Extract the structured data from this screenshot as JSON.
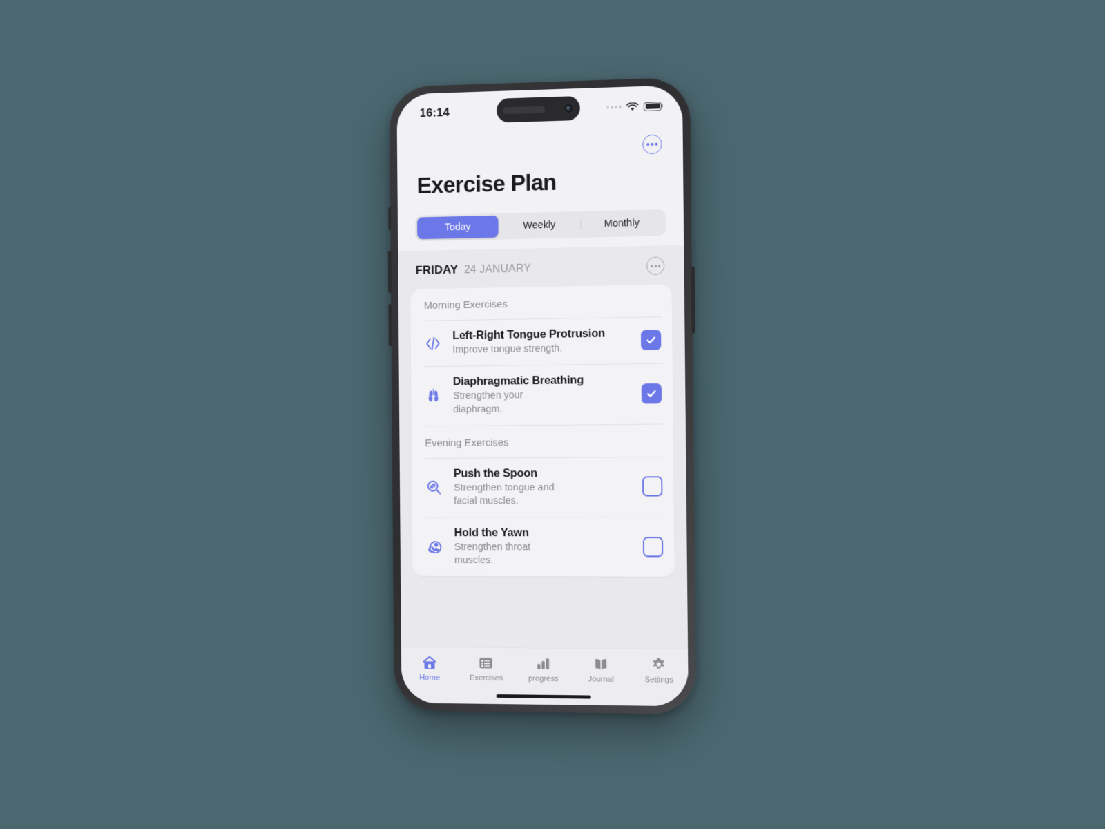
{
  "status_bar": {
    "time": "16:14",
    "cellular_icon": "cellular-dots-icon",
    "wifi_icon": "wifi-icon",
    "battery_icon": "battery-icon"
  },
  "header": {
    "title": "Exercise Plan",
    "more_button_icon": "circle-ellipsis-icon"
  },
  "segmented_control": {
    "options": [
      {
        "label": "Today",
        "active": true
      },
      {
        "label": "Weekly",
        "active": false
      },
      {
        "label": "Monthly",
        "active": false
      }
    ]
  },
  "date_header": {
    "weekday": "FRIDAY",
    "day_month": "24 JANUARY",
    "more_button_icon": "circle-ellipsis-icon"
  },
  "sections": [
    {
      "heading": "Morning Exercises",
      "items": [
        {
          "title": "Left-Right Tongue Protrusion",
          "subtitle": "Improve tongue strength.",
          "icon": "code-brackets-icon",
          "checked": true
        },
        {
          "title": "Diaphragmatic Breathing",
          "subtitle": "Strengthen your diaphragm.",
          "icon": "lungs-icon",
          "checked": true
        }
      ]
    },
    {
      "heading": "Evening Exercises",
      "items": [
        {
          "title": "Push the Spoon",
          "subtitle": "Strengthen tongue and facial muscles.",
          "icon": "magnifier-resize-icon",
          "checked": false
        },
        {
          "title": "Hold the Yawn",
          "subtitle": "Strengthen throat muscles.",
          "icon": "person-clock-icon",
          "checked": false
        }
      ]
    }
  ],
  "tab_bar": {
    "tabs": [
      {
        "label": "Home",
        "icon": "home-icon",
        "active": true
      },
      {
        "label": "Exercises",
        "icon": "list-icon",
        "active": false
      },
      {
        "label": "progress",
        "icon": "bar-chart-icon",
        "active": false
      },
      {
        "label": "Journal",
        "icon": "book-icon",
        "active": false
      },
      {
        "label": "Settings",
        "icon": "gear-icon",
        "active": false
      }
    ]
  },
  "colors": {
    "accent": "#6c78e8",
    "background": "#4b6770",
    "screen": "#f2f2f4",
    "card": "#f3f3f5",
    "muted_text": "#8a8a90",
    "title_text": "#1c1c1e"
  }
}
